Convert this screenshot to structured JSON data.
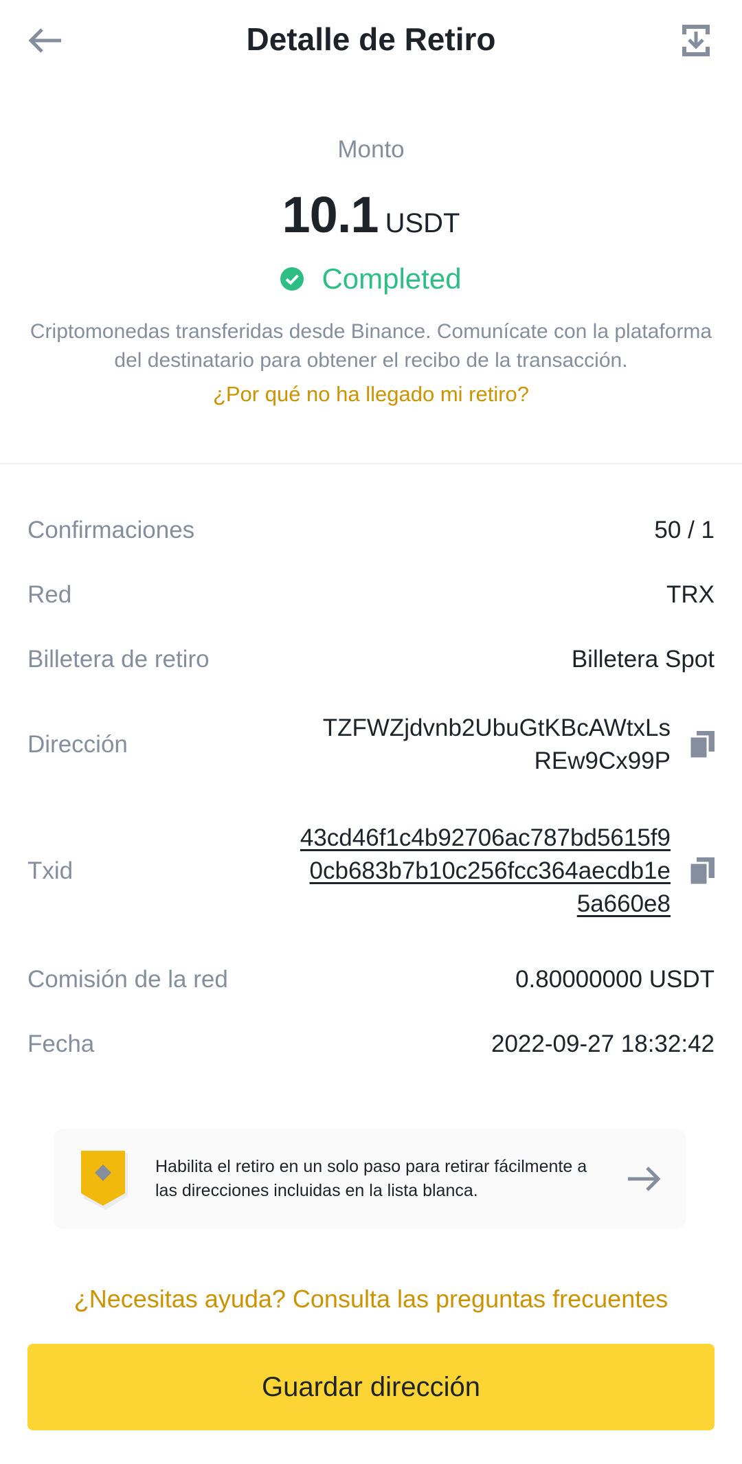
{
  "header": {
    "title": "Detalle de Retiro",
    "back_icon": "arrow-left-icon",
    "export_icon": "export-download-icon"
  },
  "amount": {
    "label": "Monto",
    "value": "10.1",
    "unit": "USDT"
  },
  "status": {
    "text": "Completed",
    "icon": "check-circle-icon",
    "color": "#2ebd85"
  },
  "description": "Criptomonedas transferidas desde Binance. Comunícate con la plataforma del destinatario para obtener el recibo de la transacción.",
  "why_link": "¿Por qué no ha llegado mi retiro?",
  "details": {
    "confirmations": {
      "label": "Confirmaciones",
      "value": "50 / 1"
    },
    "network": {
      "label": "Red",
      "value": "TRX"
    },
    "wallet": {
      "label": "Billetera de retiro",
      "value": "Billetera Spot"
    },
    "address": {
      "label": "Dirección",
      "value": "TZFWZjdvnb2UbuGtKBcAWtxLsREw9Cx99P",
      "copy_icon": "copy-icon"
    },
    "txid": {
      "label": "Txid",
      "value": "43cd46f1c4b92706ac787bd5615f90cb683b7b10c256fcc364aecdb1e5a660e8",
      "copy_icon": "copy-icon"
    },
    "fee": {
      "label": "Comisión de la red",
      "value": "0.80000000 USDT"
    },
    "date": {
      "label": "Fecha",
      "value": "2022-09-27 18:32:42"
    }
  },
  "promo": {
    "text": "Habilita el retiro en un solo paso para retirar fácilmente a las direcciones incluidas en la lista blanca.",
    "icon": "shield-badge-icon",
    "arrow_icon": "arrow-right-icon"
  },
  "faq_link": "¿Necesitas ayuda? Consulta las preguntas frecuentes",
  "save_button": "Guardar dirección",
  "colors": {
    "accent": "#fcd535",
    "link": "#c99400",
    "success": "#2ebd85",
    "muted": "#848e9c",
    "text": "#1e2329"
  }
}
